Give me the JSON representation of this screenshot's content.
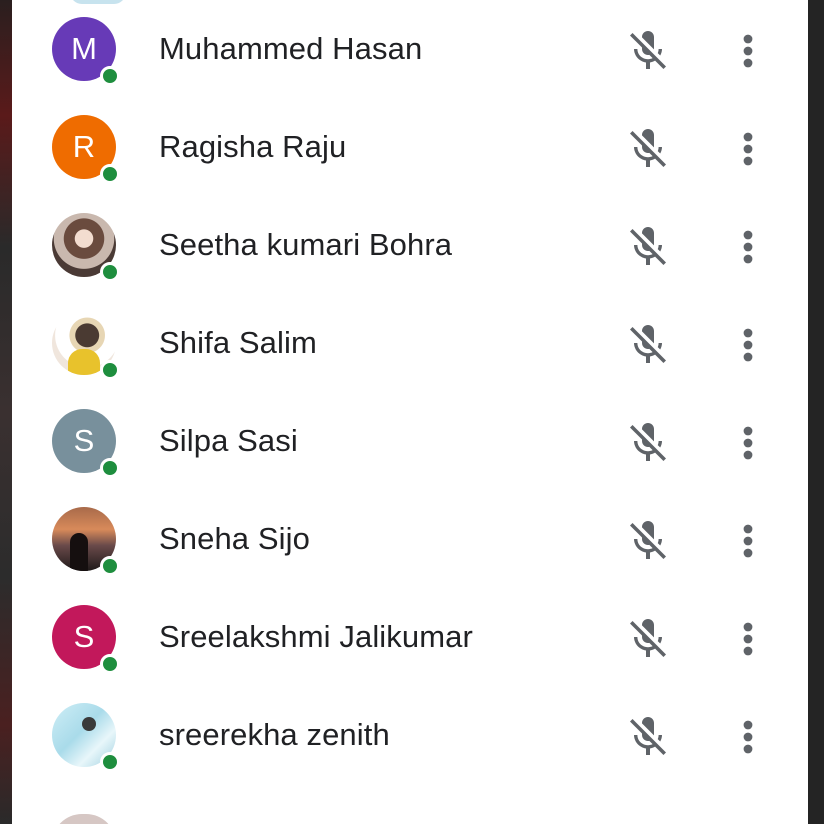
{
  "colors": {
    "panel_bg": "#ffffff",
    "name_text": "#202124",
    "online_dot": "#1e8e3e",
    "icon_gray": "#5f6368"
  },
  "participants": [
    {
      "name": "Muhammed Hasan",
      "initial": "M",
      "avatar_color": "#673ab7",
      "online": true,
      "mic": "mic-off-icon"
    },
    {
      "name": "Ragisha Raju",
      "initial": "R",
      "avatar_color": "#ef6c00",
      "online": true,
      "mic": "mic-off-icon"
    },
    {
      "name": "Seetha kumari Bohra",
      "initial": "",
      "avatar_color": "",
      "online": true,
      "mic": "mic-off-icon"
    },
    {
      "name": "Shifa Salim",
      "initial": "",
      "avatar_color": "",
      "online": true,
      "mic": "mic-off-icon"
    },
    {
      "name": "Silpa Sasi",
      "initial": "S",
      "avatar_color": "#78909c",
      "online": true,
      "mic": "mic-off-icon"
    },
    {
      "name": "Sneha Sijo",
      "initial": "",
      "avatar_color": "",
      "online": true,
      "mic": "mic-off-icon"
    },
    {
      "name": "Sreelakshmi Jalikumar",
      "initial": "S",
      "avatar_color": "#c2185b",
      "online": true,
      "mic": "mic-off-icon"
    },
    {
      "name": "sreerekha zenith",
      "initial": "",
      "avatar_color": "",
      "online": true,
      "mic": "mic-off-icon"
    }
  ]
}
